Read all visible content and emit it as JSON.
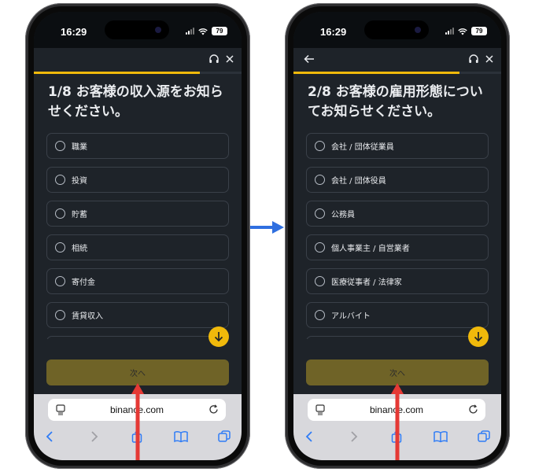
{
  "colors": {
    "accent": "#f0b90b",
    "page_bg": "#1e2329",
    "annotation_red": "#e53935",
    "annotation_blue": "#2f6fe0"
  },
  "screens": [
    {
      "status_bar": {
        "time": "16:29",
        "battery": "79"
      },
      "show_back": false,
      "progress": 0.125,
      "question": "1/8 お客様の収入源をお知らせください。",
      "options": [
        "職業",
        "投資",
        "貯蓄",
        "相続",
        "寄付金",
        "賃貸収入"
      ],
      "next_button": "次へ",
      "browser": {
        "url": "binance.com"
      }
    },
    {
      "status_bar": {
        "time": "16:29",
        "battery": "79"
      },
      "show_back": true,
      "progress": 0.25,
      "question": "2/8 お客様の雇用形態についてお知らせください。",
      "options": [
        "会社 / 団体従業員",
        "会社 / 団体役員",
        "公務員",
        "個人事業主 / 自営業者",
        "医療従事者 / 法律家",
        "アルバイト"
      ],
      "next_button": "次へ",
      "browser": {
        "url": "binance.com"
      }
    }
  ],
  "icons": [
    "back-arrow-icon",
    "headset-icon",
    "close-icon",
    "arrow-down-icon",
    "page-icon",
    "reload-icon",
    "chevron-left-icon",
    "chevron-right-icon",
    "share-icon",
    "book-icon",
    "tabs-icon"
  ]
}
